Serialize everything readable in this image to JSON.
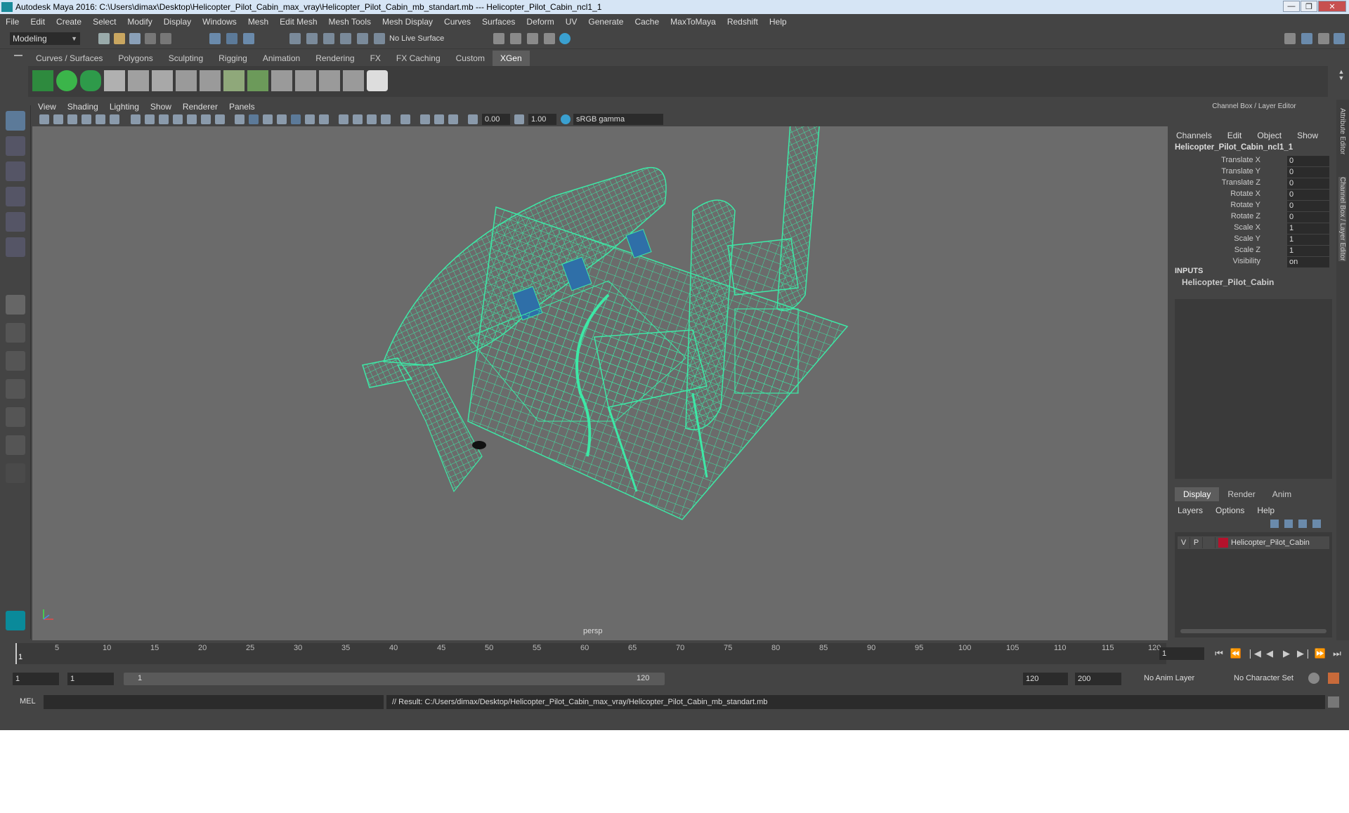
{
  "window": {
    "title": "Autodesk Maya 2016: C:\\Users\\dimax\\Desktop\\Helicopter_Pilot_Cabin_max_vray\\Helicopter_Pilot_Cabin_mb_standart.mb   ---   Helicopter_Pilot_Cabin_ncl1_1",
    "minimize": "—",
    "maximize": "❐",
    "close": "✕"
  },
  "menu": [
    "File",
    "Edit",
    "Create",
    "Select",
    "Modify",
    "Display",
    "Windows",
    "Mesh",
    "Edit Mesh",
    "Mesh Tools",
    "Mesh Display",
    "Curves",
    "Surfaces",
    "Deform",
    "UV",
    "Generate",
    "Cache",
    "MaxToMaya",
    "Redshift",
    "Help"
  ],
  "statusline": {
    "mode": "Modeling",
    "live_surface": "No Live Surface"
  },
  "shelf_tabs": [
    "Curves / Surfaces",
    "Polygons",
    "Sculpting",
    "Rigging",
    "Animation",
    "Rendering",
    "FX",
    "FX Caching",
    "Custom",
    "XGen"
  ],
  "active_shelf": "XGen",
  "viewport": {
    "menu": [
      "View",
      "Shading",
      "Lighting",
      "Show",
      "Renderer",
      "Panels"
    ],
    "exposure": "0.00",
    "gamma": "1.00",
    "color_space": "sRGB gamma",
    "camera_label": "persp"
  },
  "channel_box": {
    "header": "Channel Box / Layer Editor",
    "menu": [
      "Channels",
      "Edit",
      "Object",
      "Show"
    ],
    "object_name": "Helicopter_Pilot_Cabin_ncl1_1",
    "channels": [
      {
        "label": "Translate X",
        "value": "0"
      },
      {
        "label": "Translate Y",
        "value": "0"
      },
      {
        "label": "Translate Z",
        "value": "0"
      },
      {
        "label": "Rotate X",
        "value": "0"
      },
      {
        "label": "Rotate Y",
        "value": "0"
      },
      {
        "label": "Rotate Z",
        "value": "0"
      },
      {
        "label": "Scale X",
        "value": "1"
      },
      {
        "label": "Scale Y",
        "value": "1"
      },
      {
        "label": "Scale Z",
        "value": "1"
      },
      {
        "label": "Visibility",
        "value": "on"
      }
    ],
    "inputs_label": "INPUTS",
    "input_name": "Helicopter_Pilot_Cabin"
  },
  "layer_editor": {
    "tabs": [
      "Display",
      "Render",
      "Anim"
    ],
    "active_tab": "Display",
    "menu": [
      "Layers",
      "Options",
      "Help"
    ],
    "layer": {
      "v": "V",
      "p": "P",
      "name": "Helicopter_Pilot_Cabin",
      "color": "#b4122c"
    }
  },
  "side_tabs": {
    "attribute_editor": "Attribute Editor",
    "channel_box": "Channel Box / Layer Editor"
  },
  "timeline": {
    "ticks": [
      "5",
      "10",
      "15",
      "20",
      "25",
      "30",
      "35",
      "40",
      "45",
      "50",
      "55",
      "60",
      "65",
      "70",
      "75",
      "80",
      "85",
      "90",
      "95",
      "100",
      "105",
      "110",
      "115",
      "120"
    ],
    "current_marker": "1",
    "current_frame": "1"
  },
  "range": {
    "start_field": "1",
    "playback_start": "1",
    "slider_start": "1",
    "slider_end": "120",
    "playback_end": "120",
    "end_field": "200",
    "anim_layer": "No Anim Layer",
    "char_set": "No Character Set"
  },
  "command": {
    "lang": "MEL",
    "result": "// Result: C:/Users/dimax/Desktop/Helicopter_Pilot_Cabin_max_vray/Helicopter_Pilot_Cabin_mb_standart.mb"
  },
  "colors": {
    "wireframe": "#3de8a6",
    "bg": "#444444",
    "viewport": "#6b6b6b",
    "selected_tab": "#5d5d5d"
  }
}
